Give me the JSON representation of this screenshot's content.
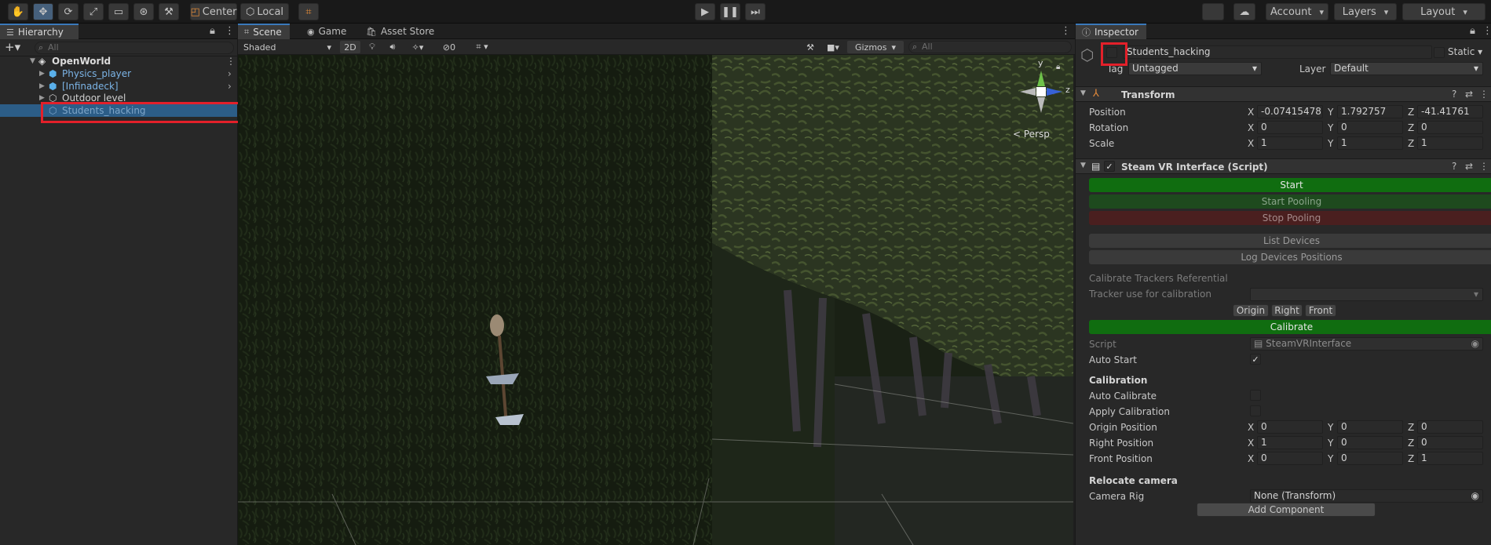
{
  "toolbar": {
    "pivot_label": "Center",
    "space_label": "Local",
    "account_label": "Account",
    "layers_label": "Layers",
    "layout_label": "Layout"
  },
  "hierarchy": {
    "tab": "Hierarchy",
    "search_placeholder": "All",
    "items": [
      {
        "label": "OpenWorld"
      },
      {
        "label": "Physics_player"
      },
      {
        "label": "[Infinadeck]"
      },
      {
        "label": "Outdoor level"
      },
      {
        "label": "Students_hacking"
      }
    ]
  },
  "scene": {
    "tabs": [
      {
        "label": "Scene"
      },
      {
        "label": "Game"
      },
      {
        "label": "Asset Store"
      }
    ],
    "shading": "Shaded",
    "mode_2d": "2D",
    "hidden_count": "0",
    "gizmos": "Gizmos",
    "search_placeholder": "All",
    "gizmo_y": "y",
    "gizmo_z": "z",
    "persp": "Persp"
  },
  "inspector": {
    "tab": "Inspector",
    "object_name": "Students_hacking",
    "static_label": "Static",
    "tag_label": "Tag",
    "tag_value": "Untagged",
    "layer_label": "Layer",
    "layer_value": "Default",
    "axis_x": "X",
    "axis_y": "Y",
    "axis_z": "Z",
    "transform": {
      "title": "Transform",
      "rows": [
        {
          "label": "Position",
          "x": "-0.07415478",
          "y": "1.792757",
          "z": "-41.41761"
        },
        {
          "label": "Rotation",
          "x": "0",
          "y": "0",
          "z": "0"
        },
        {
          "label": "Scale",
          "x": "1",
          "y": "1",
          "z": "1"
        }
      ]
    },
    "script_comp": {
      "title": "Steam VR Interface (Script)",
      "start": "Start",
      "start_pooling": "Start Pooling",
      "stop_pooling": "Stop Pooling",
      "list_devices": "List Devices",
      "log_positions": "Log Devices Positions",
      "calib_ref": "Calibrate Trackers Referential",
      "tracker_use": "Tracker use for calibration",
      "origin": "Origin",
      "right": "Right",
      "front": "Front",
      "calibrate": "Calibrate",
      "script_label": "Script",
      "script_value": "SteamVRInterface",
      "auto_start": "Auto Start",
      "calibration_header": "Calibration",
      "auto_calibrate": "Auto Calibrate",
      "apply_calibration": "Apply Calibration",
      "calib_rows": [
        {
          "label": "Origin Position",
          "x": "0",
          "y": "0",
          "z": "0"
        },
        {
          "label": "Right Position",
          "x": "1",
          "y": "0",
          "z": "0"
        },
        {
          "label": "Front Position",
          "x": "0",
          "y": "0",
          "z": "1"
        }
      ],
      "relocate_header": "Relocate camera",
      "camera_rig": "Camera Rig",
      "camera_rig_value": "None (Transform)",
      "add_component": "Add Component"
    }
  },
  "colors": {
    "selection": "#2c5d87",
    "accent_red": "#e3202a",
    "green_button": "#106d10",
    "red_button": "#6a1b1b"
  }
}
